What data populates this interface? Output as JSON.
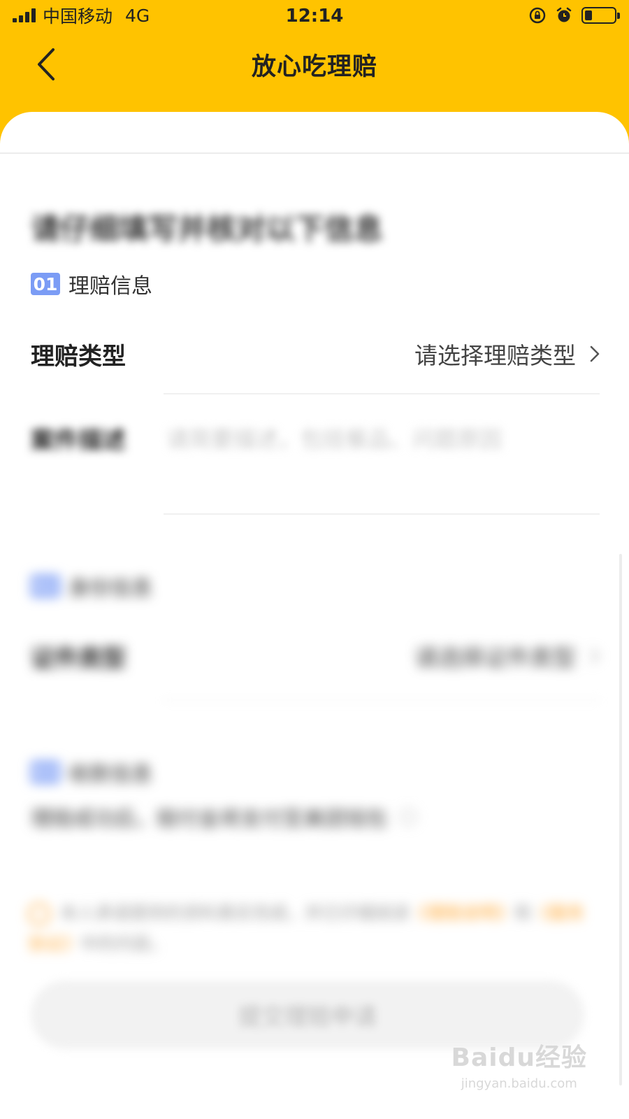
{
  "status_bar": {
    "carrier": "中国移动",
    "network": "4G",
    "time": "12:14",
    "battery_level": 0.25
  },
  "nav": {
    "title": "放心吃理赔",
    "back_icon": "chevron-left-icon"
  },
  "form": {
    "intro_text": "请仔细填写并核对以下信息",
    "sections": [
      {
        "number": "01",
        "title": "理赔信息"
      },
      {
        "number": "02",
        "title": "身份信息"
      },
      {
        "number": "03",
        "title": "收款信息"
      }
    ],
    "claim_type": {
      "label": "理赔类型",
      "placeholder": "请选择理赔类型"
    },
    "case_desc": {
      "label": "案件描述",
      "placeholder": "请简要描述，包括餐品、问题原因"
    },
    "id_type": {
      "label": "证件类型",
      "placeholder": "请选择证件类型"
    },
    "payout_note": "理赔成功后，赔付金将支付至美团钱包"
  },
  "notice": {
    "text_before": "本人承诺提供的资料真实完成，并已仔细阅读",
    "link1": "《理赔说明》",
    "conjunction": "和",
    "link2": "《服务协议》",
    "text_after": "中的内容。"
  },
  "submit_label": "提交理赔申请",
  "watermark": {
    "main": "Baidu经验",
    "sub": "jingyan.baidu.com"
  },
  "colors": {
    "header_bg": "#ffc300",
    "section_badge": "#7b9cf5",
    "link_orange": "#ffa733"
  }
}
